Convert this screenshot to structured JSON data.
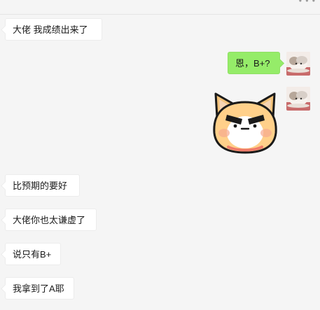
{
  "chat": {
    "messages": [
      {
        "side": "left",
        "text": "大佬  我成绩出来了"
      },
      {
        "side": "right",
        "text": "恩，B+?"
      },
      {
        "side": "right",
        "type": "sticker",
        "sticker": "corgi-frown-sticker"
      },
      {
        "side": "left",
        "text": "比预期的要好"
      },
      {
        "side": "left",
        "text": "大佬你也太谦虚了"
      },
      {
        "side": "left",
        "text": "说只有B+"
      },
      {
        "side": "left",
        "text": "我拿到了A耶"
      }
    ]
  },
  "header": {
    "more_icon": "more-dots-icon"
  },
  "colors": {
    "background": "#f5f5f5",
    "self_bubble": "#95ec69",
    "other_bubble": "#ffffff"
  }
}
